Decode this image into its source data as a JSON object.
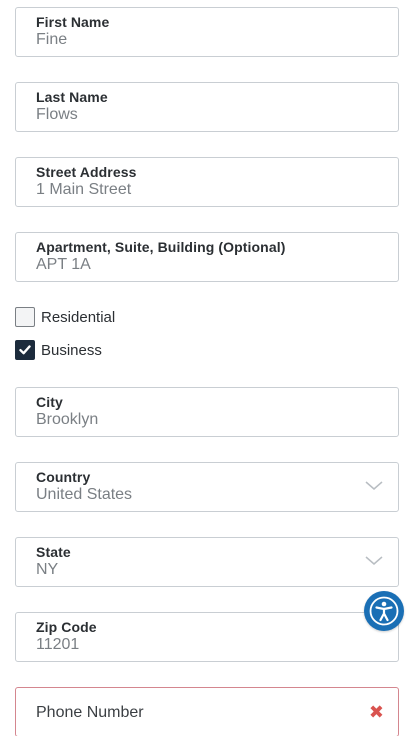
{
  "form": {
    "first_name": {
      "label": "First Name",
      "value": "Fine"
    },
    "last_name": {
      "label": "Last Name",
      "value": "Flows"
    },
    "street": {
      "label": "Street Address",
      "value": "1 Main Street"
    },
    "apartment": {
      "label": "Apartment, Suite, Building (Optional)",
      "value": "APT 1A"
    },
    "address_type": {
      "residential": {
        "label": "Residential",
        "checked": false
      },
      "business": {
        "label": "Business",
        "checked": true
      }
    },
    "city": {
      "label": "City",
      "value": "Brooklyn"
    },
    "country": {
      "label": "Country",
      "value": "United States"
    },
    "state": {
      "label": "State",
      "value": "NY"
    },
    "zip": {
      "label": "Zip Code",
      "value": "11201"
    },
    "phone": {
      "placeholder": "Phone Number",
      "error_icon": "close-icon"
    }
  },
  "accessibility_button": {
    "icon": "accessibility-icon",
    "color": "#1a6fb5"
  },
  "colors": {
    "error": "#d9534f",
    "checkbox_checked": "#1c2b3c"
  }
}
